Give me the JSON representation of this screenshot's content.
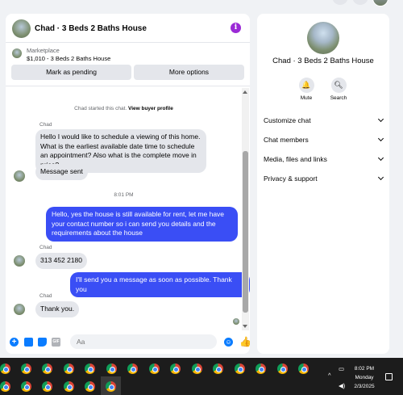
{
  "chat": {
    "title": "Chad · 3 Beds 2 Baths House",
    "info_icon": "info-icon",
    "marketplace_label": "Marketplace",
    "listing": "$1,010 - 3 Beds 2 Baths House",
    "buttons": {
      "pending": "Mark as pending",
      "more": "More options"
    },
    "system_prefix": "Chad started this chat. ",
    "system_link": "View buyer profile",
    "messages": {
      "sender": "Chad",
      "m1": "Hello I would like to schedule a viewing of this home. What is the earliest available date time to schedule an appointment? Also what is the complete move in price?",
      "m2": "Message sent",
      "timestamp": "8:01 PM",
      "m3": "Hello, yes the house is still available for rent, let me have your contact number so i can send you details and the requirements about the house",
      "m4": "313 452 2180",
      "m5": "I'll send you a message as soon as possible. Thank you",
      "m6": "Thank you."
    },
    "composer": {
      "placeholder": "Aa",
      "gif_label": "GIF"
    }
  },
  "profile": {
    "name": "Chad · 3 Beds 2 Baths House",
    "actions": {
      "mute": "Mute",
      "search": "Search"
    },
    "sections": [
      "Customize chat",
      "Chat members",
      "Media, files and links",
      "Privacy & support"
    ]
  },
  "taskbar": {
    "time": "8:02 PM",
    "day": "Monday",
    "date": "2/3/2025"
  },
  "colors": {
    "accent": "#0a7cff",
    "outgoing": "#3a4ef5",
    "incoming": "#e4e6eb"
  }
}
